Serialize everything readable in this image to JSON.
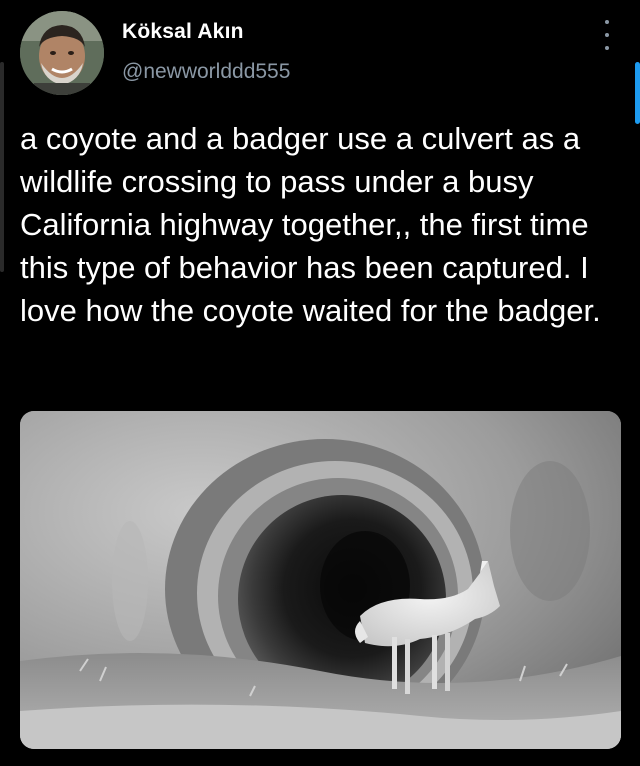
{
  "tweet": {
    "author": {
      "display_name": "Köksal Akın",
      "handle": "@newworlddd555"
    },
    "text": "a coyote and a badger use a culvert as a wildlife crossing to pass under a busy California highway together,, the first time this type of behavior has been captured. I love how the coyote waited for the badger.",
    "more_icon": "vertical-ellipsis-icon"
  },
  "media": {
    "type": "night-vision photo",
    "scene": "coyote-in-culvert"
  },
  "colors": {
    "background": "#000000",
    "text": "#ffffff",
    "secondary_text": "#8b98a5",
    "accent": "#1d9bf0"
  }
}
